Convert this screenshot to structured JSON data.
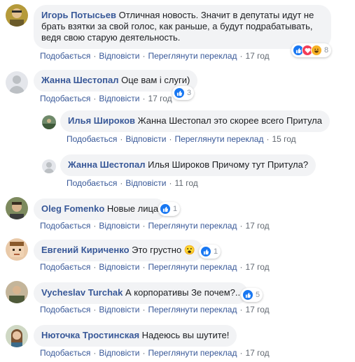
{
  "actions": {
    "like": "Подобається",
    "reply": "Відповісти",
    "translate": "Переглянути переклад",
    "dot": "·"
  },
  "comments": [
    {
      "author": "Игорь Потысьев",
      "text": "Отличная новость. Значит в депутаты идут не брать взятки за свой голос, как раньше, а будут подрабатывать, ведя свою старую деятельность.",
      "time": "17 год",
      "reactions": "8"
    },
    {
      "author": "Жанна Шестопал",
      "text": "Оце вам і слуги)",
      "time": "17 год",
      "reactions": "3"
    },
    {
      "author": "Илья Широков",
      "text": "Жанна Шестопал это скорее всего Притула",
      "time": "15 год"
    },
    {
      "author": "Жанна Шестопал",
      "text": "Илья Широков Причому тут Притула?",
      "time": "11 год"
    },
    {
      "author": "Oleg Fomenko",
      "text": "Новые лица",
      "time": "17 год",
      "reactions": "1"
    },
    {
      "author": "Евгений Кириченко",
      "text": "Это грустно",
      "emoji": "😮",
      "time": "17 год",
      "reactions": "1"
    },
    {
      "author": "Vycheslav Turchak",
      "text": "А корпоративы Зе почем?..",
      "time": "17 год",
      "reactions": "5"
    },
    {
      "author": "Нюточка Тростинская",
      "text": "Надеюсь вы шутите!",
      "time": "17 год"
    }
  ],
  "colors": {
    "link": "#385898",
    "bubble": "#f2f3f5",
    "meta": "#606770",
    "like": "#1877f2",
    "love": "#f33e58",
    "haha": "#f7b125"
  }
}
